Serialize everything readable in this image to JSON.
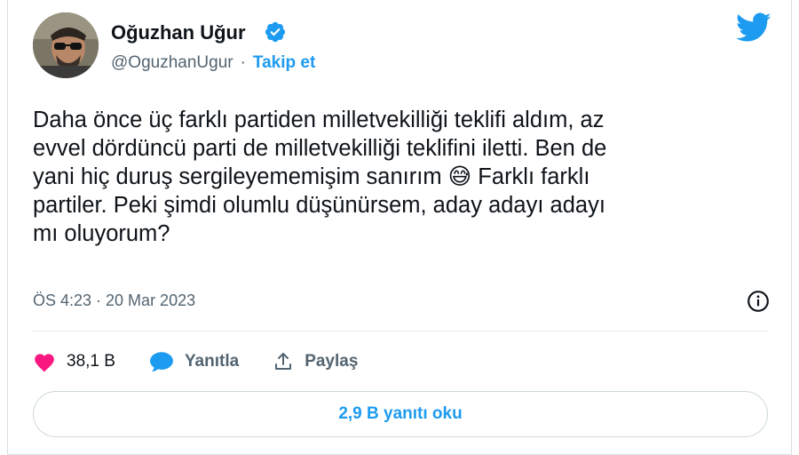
{
  "author": {
    "name": "Oğuzhan Uğur",
    "handle": "@OguzhanUgur",
    "separator": "·",
    "follow_label": "Takip et"
  },
  "tweet": {
    "text": "Daha önce üç farklı partiden milletvekilliği teklifi aldım, az\nevvel dördüncü parti de milletvekilliği teklifini iletti. Ben de\nyani hiç duruş sergileyememişim sanırım 😅 Farklı farklı\npartiler. Peki şimdi olumlu düşünürsem, aday adayı adayı\nmı oluyorum?",
    "timestamp": "ÖS 4:23 · 20 Mar 2023"
  },
  "actions": {
    "likes": "38,1 B",
    "reply_label": "Yanıtla",
    "share_label": "Paylaş"
  },
  "read_replies_label": "2,9 B yanıtı oku",
  "colors": {
    "accent": "#1d9bf0",
    "like": "#f91880",
    "muted": "#536471",
    "text": "#0f1419"
  },
  "icons": [
    "verified-badge-icon",
    "twitter-bird-icon",
    "info-icon",
    "heart-icon",
    "reply-bubble-icon",
    "share-icon"
  ]
}
